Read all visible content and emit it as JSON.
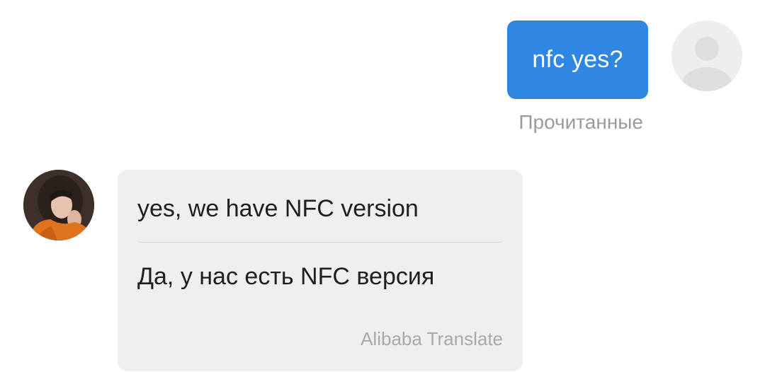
{
  "outgoing_message": {
    "text": "nfc yes?",
    "status": "Прочитанные",
    "bubble_color": "#2f86e3"
  },
  "my_avatar": {
    "icon": "default-user-icon"
  },
  "incoming_message": {
    "original_text": "yes, we have NFC version",
    "translated_text": "Да, у нас есть NFC версия",
    "translation_credit": "Alibaba Translate",
    "bubble_color": "#efefef"
  },
  "their_avatar": {
    "icon": "user-photo-avatar"
  }
}
